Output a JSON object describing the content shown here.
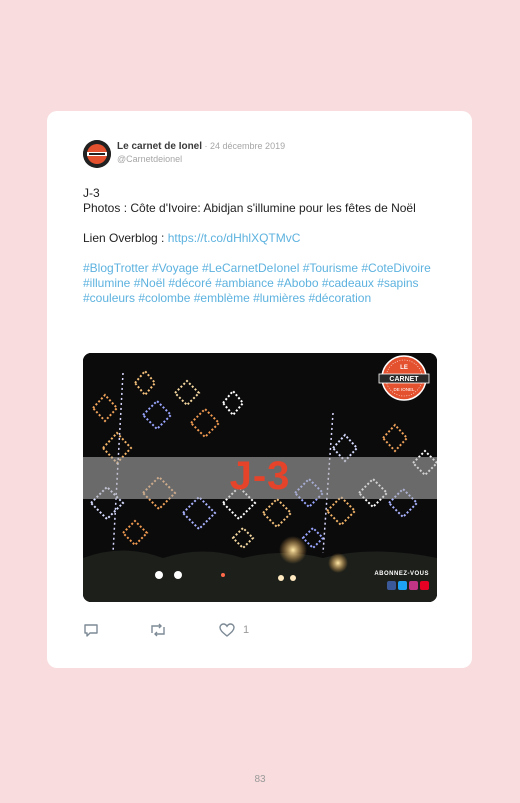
{
  "tweet": {
    "author_name": "Le carnet de Ionel",
    "date": " · 24 décembre 2019",
    "handle": "@Carnetdeionel",
    "line1": "J-3",
    "line2": "Photos : Côte d'Ivoire: Abidjan s'illumine pour les fêtes de Noël",
    "link_label": "Lien Overblog : ",
    "link_url": "https://t.co/dHhlXQTMvC",
    "hashtags": "#BlogTrotter #Voyage #LeCarnetDeIonel #Tourisme #CoteDivoire #illumine #Noël #décoré #ambiance #Abobo #cadeaux #sapins #couleurs #colombe #emblème #lumières #décoration",
    "image_overlay_text": "J-3",
    "logo_text_top": "LE",
    "logo_text_main": "CARNET",
    "logo_text_bottom": "DE IONEL",
    "subscribe_text": "ABONNEZ-VOUS",
    "like_count": "1"
  },
  "page_number": "83",
  "colors": {
    "background": "#f9dcdd",
    "link": "#5db2df",
    "overlay_text": "#e6432b"
  }
}
